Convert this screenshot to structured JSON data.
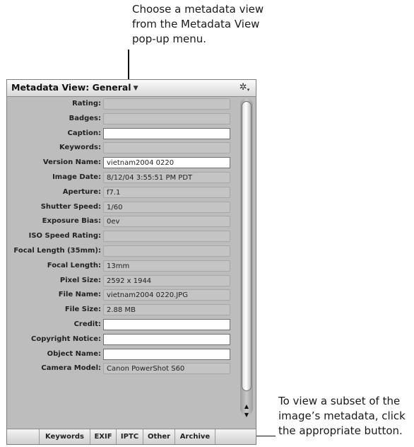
{
  "callouts": {
    "top": [
      "Choose a metadata view",
      "from the Metadata View",
      "pop-up menu."
    ],
    "right": [
      "To view a subset of the",
      "image’s metadata, click",
      "the appropriate button."
    ]
  },
  "panel": {
    "view_title": "Metadata View: General",
    "dropdown_icon": "chevron-down-icon",
    "gear_icon": "gear-icon"
  },
  "fields": [
    {
      "label": "Rating:",
      "value": "",
      "editable": false
    },
    {
      "label": "Badges:",
      "value": "",
      "editable": false
    },
    {
      "label": "Caption:",
      "value": "",
      "editable": true
    },
    {
      "label": "Keywords:",
      "value": "",
      "editable": false
    },
    {
      "label": "Version Name:",
      "value": "vietnam2004 0220",
      "editable": true
    },
    {
      "label": "Image Date:",
      "value": "8/12/04 3:55:51 PM PDT",
      "editable": false
    },
    {
      "label": "Aperture:",
      "value": "f7.1",
      "editable": false
    },
    {
      "label": "Shutter Speed:",
      "value": "1/60",
      "editable": false
    },
    {
      "label": "Exposure Bias:",
      "value": "0ev",
      "editable": false
    },
    {
      "label": "ISO Speed Rating:",
      "value": "",
      "editable": false
    },
    {
      "label": "Focal Length (35mm):",
      "value": "",
      "editable": false
    },
    {
      "label": "Focal Length:",
      "value": "13mm",
      "editable": false
    },
    {
      "label": "Pixel Size:",
      "value": "2592 x 1944",
      "editable": false
    },
    {
      "label": "File Name:",
      "value": "vietnam2004 0220.JPG",
      "editable": false
    },
    {
      "label": "File Size:",
      "value": "2.88 MB",
      "editable": false
    },
    {
      "label": "Credit:",
      "value": "",
      "editable": true
    },
    {
      "label": "Copyright Notice:",
      "value": "",
      "editable": true
    },
    {
      "label": "Object Name:",
      "value": "",
      "editable": true
    },
    {
      "label": "Camera Model:",
      "value": "Canon PowerShot S60",
      "editable": false
    }
  ],
  "tabs": [
    "Keywords",
    "EXIF",
    "IPTC",
    "Other",
    "Archive"
  ],
  "colors": {
    "panel_bg": "#bdbdbd",
    "field_editable": "#ffffff",
    "field_readonly": "#c4c4c4"
  }
}
